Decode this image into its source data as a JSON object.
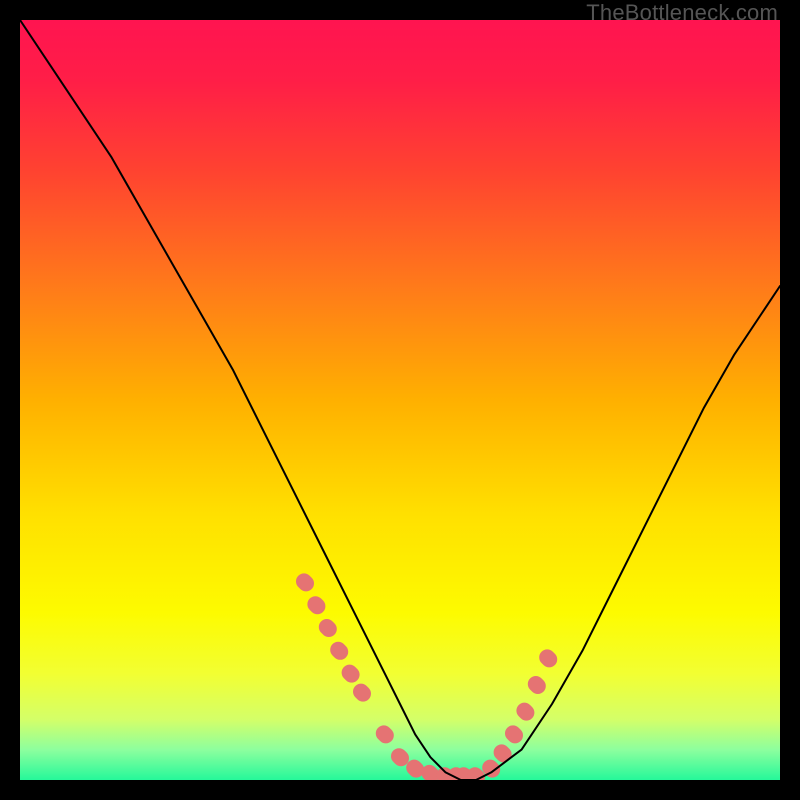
{
  "watermark": "TheBottleneck.com",
  "chart_data": {
    "type": "line",
    "title": "",
    "xlabel": "",
    "ylabel": "",
    "xlim": [
      0,
      100
    ],
    "ylim": [
      0,
      100
    ],
    "grid": false,
    "legend": false,
    "background_gradient_stops": [
      {
        "pos": 0.0,
        "color": "#ff1450"
      },
      {
        "pos": 0.08,
        "color": "#ff1e47"
      },
      {
        "pos": 0.2,
        "color": "#ff4330"
      },
      {
        "pos": 0.35,
        "color": "#ff7a1a"
      },
      {
        "pos": 0.5,
        "color": "#ffb000"
      },
      {
        "pos": 0.65,
        "color": "#ffe000"
      },
      {
        "pos": 0.78,
        "color": "#fdfb00"
      },
      {
        "pos": 0.86,
        "color": "#f2ff32"
      },
      {
        "pos": 0.92,
        "color": "#d4ff68"
      },
      {
        "pos": 0.96,
        "color": "#8dff9e"
      },
      {
        "pos": 1.0,
        "color": "#25f89a"
      }
    ],
    "series": [
      {
        "name": "curve",
        "stroke": "#000000",
        "stroke_width": 2,
        "x": [
          0,
          4,
          8,
          12,
          16,
          20,
          24,
          28,
          32,
          36,
          40,
          44,
          48,
          50,
          52,
          54,
          56,
          58,
          60,
          62,
          66,
          70,
          74,
          78,
          82,
          86,
          90,
          94,
          98,
          100
        ],
        "y": [
          100,
          94,
          88,
          82,
          75,
          68,
          61,
          54,
          46,
          38,
          30,
          22,
          14,
          10,
          6,
          3,
          1,
          0,
          0,
          1,
          4,
          10,
          17,
          25,
          33,
          41,
          49,
          56,
          62,
          65
        ]
      }
    ],
    "markers": {
      "name": "dots",
      "color": "#e57373",
      "radius_px": 8,
      "x": [
        37.5,
        39.0,
        40.5,
        42.0,
        43.5,
        45.0,
        48.0,
        50.0,
        52.0,
        54.0,
        56.0,
        57.5,
        58.5,
        60.0,
        62.0,
        63.5,
        65.0,
        66.5,
        68.0,
        69.5
      ],
      "y": [
        26.0,
        23.0,
        20.0,
        17.0,
        14.0,
        11.5,
        6.0,
        3.0,
        1.5,
        0.8,
        0.5,
        0.5,
        0.5,
        0.5,
        1.5,
        3.5,
        6.0,
        9.0,
        12.5,
        16.0
      ]
    }
  }
}
